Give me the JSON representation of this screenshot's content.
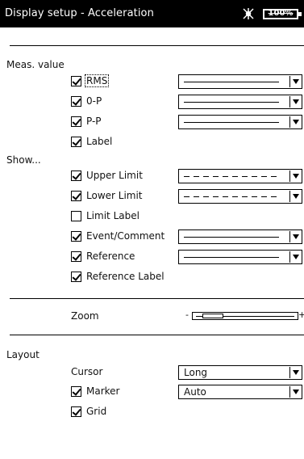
{
  "window": {
    "title": "Display setup - Acceleration",
    "battery_label": "100%",
    "status_icon": "signal-burst-icon"
  },
  "meas_value": {
    "heading": "Meas. value",
    "items": [
      {
        "label": "RMS",
        "checked": true,
        "line_style": "solid"
      },
      {
        "label": "0-P",
        "checked": true,
        "line_style": "solid"
      },
      {
        "label": "P-P",
        "checked": true,
        "line_style": "solid"
      },
      {
        "label": "Label",
        "checked": true
      }
    ]
  },
  "show": {
    "heading": "Show...",
    "items": [
      {
        "label": "Upper Limit",
        "checked": true,
        "line_style": "dashed"
      },
      {
        "label": "Lower Limit",
        "checked": true,
        "line_style": "dashed"
      },
      {
        "label": "Limit Label",
        "checked": false
      },
      {
        "label": "Event/Comment",
        "checked": true,
        "line_style": "solid"
      },
      {
        "label": "Reference",
        "checked": true,
        "line_style": "solid"
      },
      {
        "label": "Reference Label",
        "checked": true
      }
    ]
  },
  "zoom": {
    "label": "Zoom",
    "minus": "-",
    "plus": "+",
    "level": 0.1
  },
  "layout": {
    "heading": "Layout",
    "cursor": {
      "label": "Cursor",
      "value": "Long"
    },
    "marker": {
      "label": "Marker",
      "checked": true,
      "value": "Auto"
    },
    "grid": {
      "label": "Grid",
      "checked": true
    }
  }
}
